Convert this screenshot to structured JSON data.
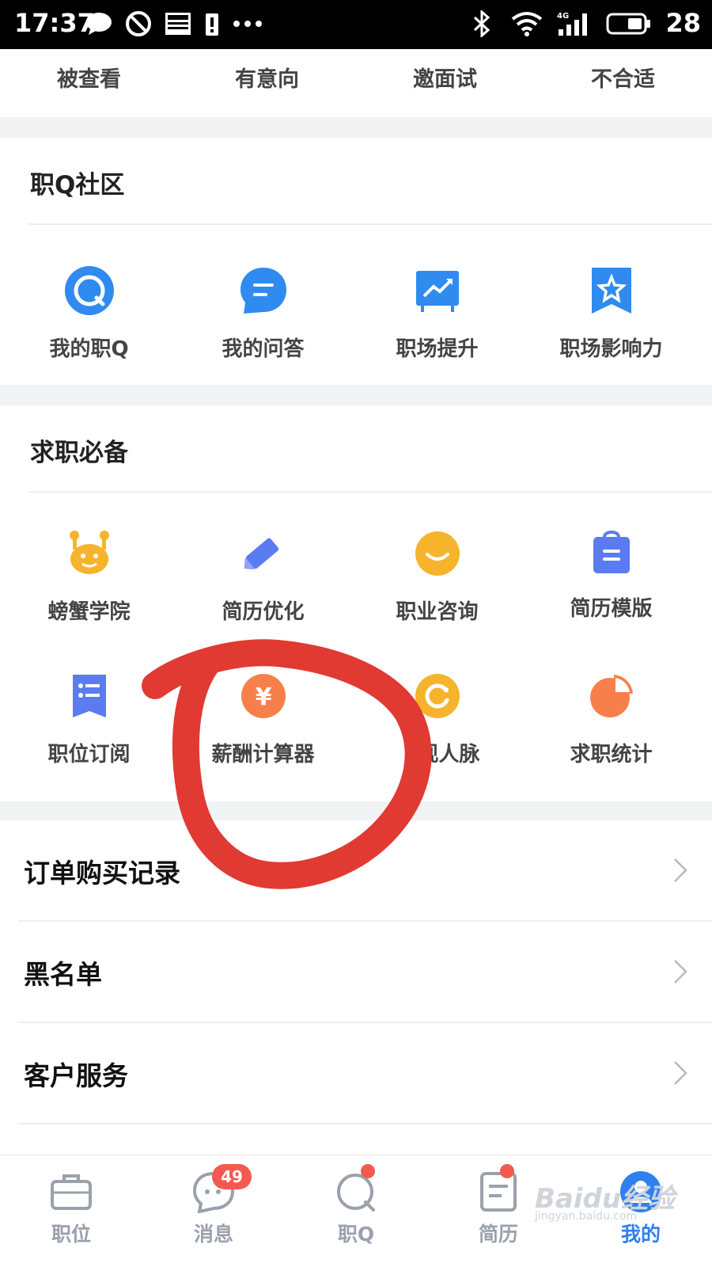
{
  "status_bar": {
    "time": "17:37",
    "battery": "28",
    "icons": [
      "chat-bubble-icon",
      "do-not-disturb-icon",
      "news-icon",
      "battery-alert-icon",
      "more-dots-icon",
      "bluetooth-icon",
      "wifi-icon",
      "signal-4g-icon",
      "battery-icon"
    ]
  },
  "delivery_tabs": [
    "被查看",
    "有意向",
    "邀面试",
    "不合适"
  ],
  "community": {
    "title": "职Q社区",
    "items": [
      {
        "label": "我的职Q",
        "icon": "zhiq-circle-icon",
        "color": "#2f8bf0"
      },
      {
        "label": "我的问答",
        "icon": "chat-lines-icon",
        "color": "#2f8bf0"
      },
      {
        "label": "职场提升",
        "icon": "trend-board-icon",
        "color": "#2f8bf0"
      },
      {
        "label": "职场影响力",
        "icon": "star-bookmark-icon",
        "color": "#2f8bf0"
      }
    ]
  },
  "essentials": {
    "title": "求职必备",
    "items": [
      {
        "label": "螃蟹学院",
        "icon": "crab-icon",
        "color": "#f6b42c"
      },
      {
        "label": "简历优化",
        "icon": "pencil-icon",
        "color": "#5b7cf0"
      },
      {
        "label": "职业咨询",
        "icon": "smile-icon",
        "color": "#f6b42c"
      },
      {
        "label": "简历模版",
        "icon": "bag-icon",
        "color": "#5b7cf0"
      },
      {
        "label": "职位订阅",
        "icon": "list-doc-icon",
        "color": "#5b7cf0"
      },
      {
        "label": "薪酬计算器",
        "icon": "yen-coin-icon",
        "color": "#f7804a"
      },
      {
        "label": "现人脉",
        "icon": "refresh-circle-icon",
        "color": "#f6b42c"
      },
      {
        "label": "求职统计",
        "icon": "pie-chart-icon",
        "color": "#f7804a"
      }
    ]
  },
  "list_rows": [
    {
      "label": "订单购买记录"
    },
    {
      "label": "黑名单"
    },
    {
      "label": "客户服务"
    }
  ],
  "bottom_nav": [
    {
      "label": "职位",
      "icon": "briefcase-icon"
    },
    {
      "label": "消息",
      "icon": "message-icon",
      "badge": "49"
    },
    {
      "label": "职Q",
      "icon": "zhiq-nav-icon"
    },
    {
      "label": "简历",
      "icon": "resume-icon"
    },
    {
      "label": "我的",
      "icon": "profile-icon"
    }
  ],
  "watermark": {
    "text": "Baidu经验",
    "sub": "jingyan.baidu.com"
  },
  "colors": {
    "accent": "#2f80ed",
    "annotation": "#e03a33",
    "badge": "#f25a4f"
  }
}
